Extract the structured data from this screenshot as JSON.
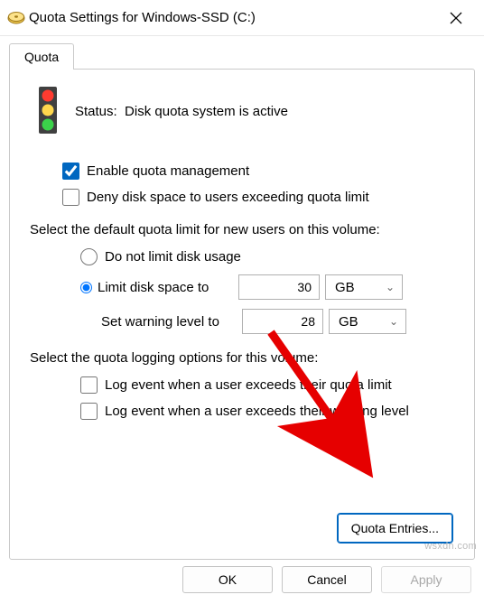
{
  "window": {
    "title": "Quota Settings for Windows-SSD (C:)"
  },
  "tab": {
    "label": "Quota"
  },
  "status": {
    "prefix": "Status:",
    "text": "Disk quota system is active"
  },
  "checkboxes": {
    "enable_management": "Enable quota management",
    "deny_space": "Deny disk space to users exceeding quota limit"
  },
  "limit_section": {
    "label": "Select the default quota limit for new users on this volume:",
    "radio_no_limit": "Do not limit disk usage",
    "radio_limit": "Limit disk space to",
    "warning_label": "Set warning level to",
    "limit_value": "30",
    "limit_unit": "GB",
    "warning_value": "28",
    "warning_unit": "GB"
  },
  "logging_section": {
    "label": "Select the quota logging options for this volume:",
    "log_quota": "Log event when a user exceeds their quota limit",
    "log_warning": "Log event when a user exceeds their warning level"
  },
  "buttons": {
    "quota_entries": "Quota Entries...",
    "ok": "OK",
    "cancel": "Cancel",
    "apply": "Apply"
  },
  "watermark": "wsxdn.com"
}
